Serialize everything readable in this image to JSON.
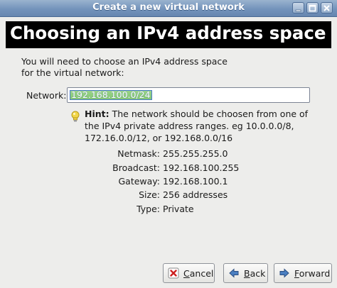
{
  "window": {
    "title": "Create a new virtual network"
  },
  "banner": {
    "heading": "Choosing an IPv4 address space"
  },
  "intro": {
    "line1": "You will need to choose an IPv4 address space",
    "line2": "for the virtual network:"
  },
  "network": {
    "label": "Network:",
    "value": "192.168.100.0/24"
  },
  "hint": {
    "label": "Hint:",
    "line1": " The network should be choosen from one of",
    "line2": "the IPv4 private address ranges. eg 10.0.0.0/8,",
    "line3": "172.16.0.0/12, or 192.168.0.0/16"
  },
  "details": [
    {
      "key": "Netmask:",
      "value": "255.255.255.0"
    },
    {
      "key": "Broadcast:",
      "value": "192.168.100.255"
    },
    {
      "key": "Gateway:",
      "value": "192.168.100.1"
    },
    {
      "key": "Size:",
      "value": "256 addresses"
    },
    {
      "key": "Type:",
      "value": "Private"
    }
  ],
  "buttons": {
    "cancel": {
      "prefix": "",
      "mnemonic": "C",
      "rest": "ancel"
    },
    "back": {
      "prefix": "",
      "mnemonic": "B",
      "rest": "ack"
    },
    "forward": {
      "prefix": "",
      "mnemonic": "F",
      "rest": "orward"
    }
  },
  "icons": {
    "minimize": "minimize-icon",
    "maximize": "maximize-icon",
    "close": "close-icon",
    "hint": "lightbulb-icon",
    "cancel": "cancel-x-icon",
    "back": "back-arrow-icon",
    "forward": "forward-arrow-icon"
  },
  "colors": {
    "titlebar": "#7393bb",
    "banner": "#000000",
    "selection": "#8fcf7e",
    "hint_bulb": "#f2d64a"
  }
}
